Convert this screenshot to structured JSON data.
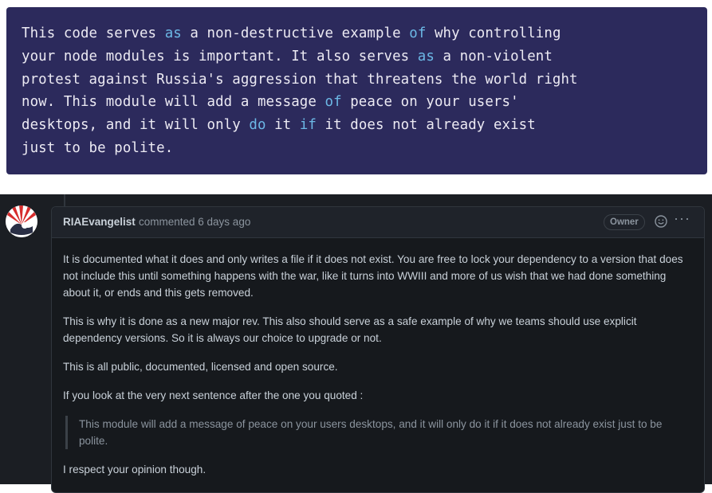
{
  "code_block": {
    "lines": [
      [
        {
          "t": "This code serves "
        },
        {
          "t": "as",
          "kw": true
        },
        {
          "t": " a non-destructive example "
        },
        {
          "t": "of",
          "kw": true
        },
        {
          "t": " why controlling"
        }
      ],
      [
        {
          "t": "your node modules is important. It also serves "
        },
        {
          "t": "as",
          "kw": true
        },
        {
          "t": " a non-violent"
        }
      ],
      [
        {
          "t": "protest against Russia's aggression that threatens the world right"
        }
      ],
      [
        {
          "t": "now. This module will add a message "
        },
        {
          "t": "of",
          "kw": true
        },
        {
          "t": " peace on your users'"
        }
      ],
      [
        {
          "t": "desktops, and it will only "
        },
        {
          "t": "do",
          "kw": true
        },
        {
          "t": " it "
        },
        {
          "t": "if",
          "kw": true
        },
        {
          "t": " it does not already exist"
        }
      ],
      [
        {
          "t": "just to be polite."
        }
      ]
    ],
    "colors": {
      "background": "#2c2a5c",
      "text": "#eceaf3",
      "keyword": "#6cb8e6"
    }
  },
  "comment": {
    "author": "RIAEvangelist",
    "meta": "commented 6 days ago",
    "badge": "Owner",
    "avatar_icon": "riaevangelist-avatar-icon",
    "reaction_icon": "smiley-icon",
    "more_icon": "kebab-horizontal-icon",
    "more_glyph": "···",
    "paragraphs": [
      "It is documented what it does and only writes a file if it does not exist. You are free to lock your dependency to a version that does not include this until something happens with the war, like it turns into WWIII and more of us wish that we had done something about it, or ends and this gets removed.",
      "This is why it is done as a new major rev. This also should serve as a safe example of why we teams should use explicit dependency versions. So it is always our choice to upgrade or not.",
      "This is all public, documented, licensed and open source.",
      "If you look at the very next sentence after the one you quoted :"
    ],
    "quote": "This module will add a message of peace on your users desktops, and it will only do it if it does not already exist just to be polite.",
    "closing": "I respect your opinion though."
  },
  "colors": {
    "page_dark": "#1b1e23",
    "box": "#16191d",
    "header": "#1f232a",
    "border": "#30363d"
  }
}
